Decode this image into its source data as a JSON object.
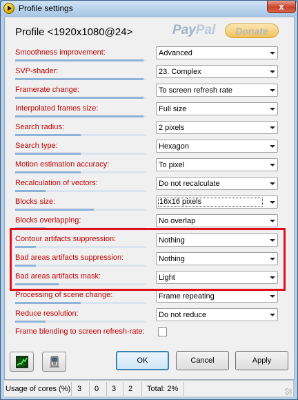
{
  "window": {
    "title": "Profile settings",
    "close_label": "x"
  },
  "header": {
    "title": "Profile <1920x1080@24>",
    "paypal_pay": "Pay",
    "paypal_pal": "Pal",
    "donate_label": "Donate"
  },
  "settings": [
    {
      "label": "Smoothness improvement:",
      "value": "Advanced",
      "level": 0.98
    },
    {
      "label": "SVP-shader:",
      "value": "23. Complex",
      "level": 0.98
    },
    {
      "label": "Framerate change:",
      "value": "To screen refresh rate",
      "level": 0.98
    },
    {
      "label": "Interpolated frames size:",
      "value": "Full size",
      "level": 0.98
    },
    {
      "label": "Search radius:",
      "value": "2 pixels",
      "level": 0.5
    },
    {
      "label": "Search type:",
      "value": "Hexagon",
      "level": 0.5
    },
    {
      "label": "Motion estimation accuracy:",
      "value": "To pixel",
      "level": 0.5
    },
    {
      "label": "Recalculation of vectors:",
      "value": "Do not recalculate",
      "level": 0.23
    },
    {
      "label": "Blocks size:",
      "value": "16x16 pixels",
      "level": 0.6
    },
    {
      "label": "Blocks overlapping:",
      "value": "No overlap",
      "level": 0.23
    },
    {
      "label": "Contour artifacts suppression:",
      "value": "Nothing",
      "level": 0.16
    },
    {
      "label": "Bad areas artifacts suppression:",
      "value": "Nothing",
      "level": 0.16
    },
    {
      "label": "Bad areas artifacts mask:",
      "value": "Light",
      "level": 0.33
    },
    {
      "label": "Processing of scene change:",
      "value": "Frame repeating",
      "level": 0.5
    },
    {
      "label": "Reduce resolution:",
      "value": "Do not reduce",
      "level": 0.23
    }
  ],
  "frame_blending": {
    "label": "Frame blending to screen refresh-rate:",
    "checked": false
  },
  "tools": {
    "graph_icon": "graph-icon",
    "device_icon": "device-icon"
  },
  "buttons": {
    "ok": "OK",
    "cancel": "Cancel",
    "apply": "Apply"
  },
  "status": {
    "cores_label": "Usage of cores (%):",
    "cores": [
      "3",
      "0",
      "3",
      "2"
    ],
    "total": "Total: 2%"
  },
  "colors": {
    "label_red": "#c00000",
    "highlight": "#e0101a",
    "accent": "#3c7fb1"
  }
}
